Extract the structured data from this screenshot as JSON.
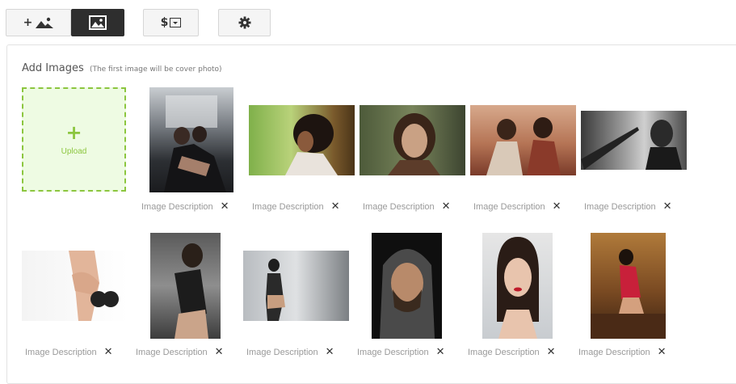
{
  "tabs": [
    {
      "label": "+",
      "icon": "landscape-icon",
      "active": false
    },
    {
      "icon": "image-icon",
      "active": true
    },
    {
      "label": "$",
      "icon": "price-dropdown-icon",
      "active": false
    },
    {
      "icon": "gear-icon",
      "active": false
    }
  ],
  "section": {
    "title": "Add Images",
    "hint": "(The first image will be cover photo)"
  },
  "upload": {
    "plus": "+",
    "label": "Upload"
  },
  "remove_glyph": "✕",
  "images": [
    {
      "description": "Image Description"
    },
    {
      "description": "Image Description"
    },
    {
      "description": "Image Description"
    },
    {
      "description": "Image Description"
    },
    {
      "description": "Image Description"
    },
    {
      "description": "Image Description"
    },
    {
      "description": "Image Description"
    },
    {
      "description": "Image Description"
    },
    {
      "description": "Image Description"
    },
    {
      "description": "Image Description"
    },
    {
      "description": "Image Description"
    }
  ],
  "colors": {
    "accent": "#8cc63f",
    "active_tab": "#2e2e2e"
  }
}
